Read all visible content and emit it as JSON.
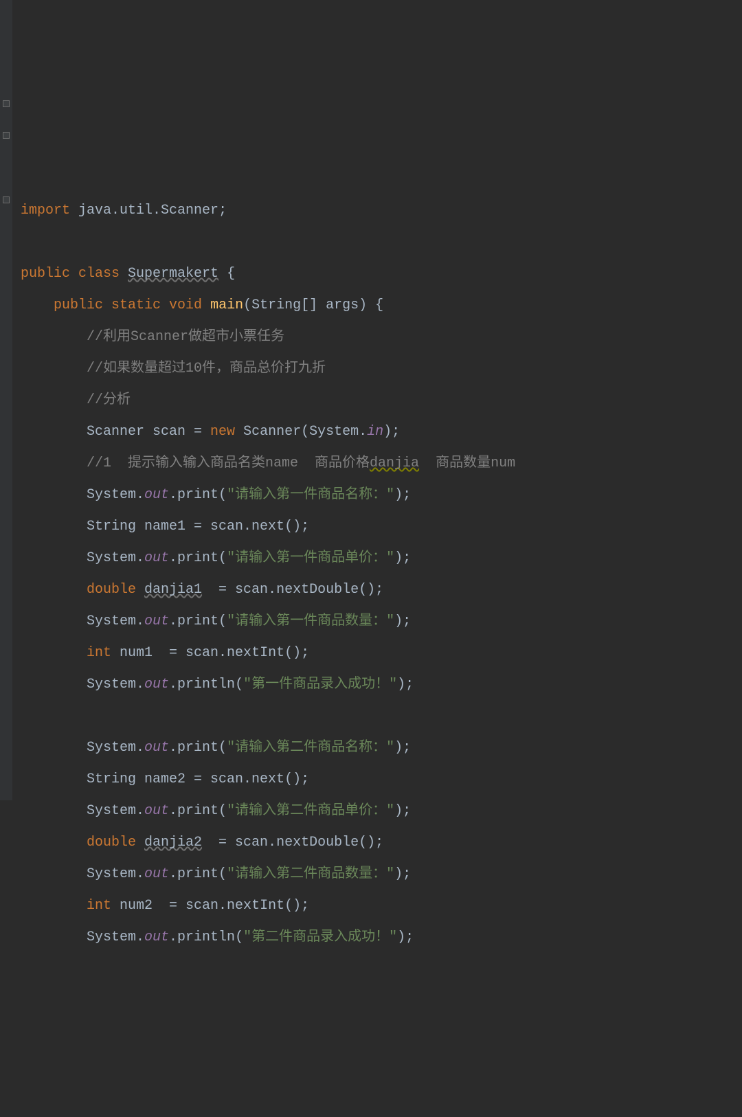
{
  "code": {
    "lines": [
      {
        "indent": 0,
        "tokens": [
          {
            "cls": "kw",
            "t": "import "
          },
          {
            "cls": "pkg",
            "t": "java.util.Scanner"
          },
          {
            "cls": "punct",
            "t": ";"
          }
        ]
      },
      {
        "indent": 0,
        "tokens": []
      },
      {
        "indent": 0,
        "tokens": [
          {
            "cls": "kw",
            "t": "public class "
          },
          {
            "cls": "cls",
            "t": "Supermakert"
          },
          {
            "cls": "punct",
            "t": " {"
          }
        ]
      },
      {
        "indent": 1,
        "tokens": [
          {
            "cls": "kw",
            "t": "public static void "
          },
          {
            "cls": "method-decl",
            "t": "main"
          },
          {
            "cls": "punct",
            "t": "(String[] args) {"
          }
        ]
      },
      {
        "indent": 2,
        "tokens": [
          {
            "cls": "comment",
            "t": "//利用Scanner做超市小票任务"
          }
        ]
      },
      {
        "indent": 2,
        "tokens": [
          {
            "cls": "comment",
            "t": "//如果数量超过10件，商品总价打九折"
          }
        ]
      },
      {
        "indent": 2,
        "tokens": [
          {
            "cls": "comment",
            "t": "//分析"
          }
        ]
      },
      {
        "indent": 2,
        "tokens": [
          {
            "cls": "type",
            "t": "Scanner scan = "
          },
          {
            "cls": "kw",
            "t": "new "
          },
          {
            "cls": "type",
            "t": "Scanner(System."
          },
          {
            "cls": "field-italic",
            "t": "in"
          },
          {
            "cls": "punct",
            "t": ");"
          }
        ]
      },
      {
        "indent": 2,
        "tokens": [
          {
            "cls": "comment",
            "t": "//1  提示输入输入商品名类name  商品价格"
          },
          {
            "cls": "comment warn-underline-y",
            "t": "danjia"
          },
          {
            "cls": "comment",
            "t": "  商品数量num"
          }
        ]
      },
      {
        "indent": 2,
        "tokens": [
          {
            "cls": "var",
            "t": "System."
          },
          {
            "cls": "field-italic",
            "t": "out"
          },
          {
            "cls": "var",
            "t": ".print("
          },
          {
            "cls": "string",
            "t": "\"请输入第一件商品名称：\""
          },
          {
            "cls": "punct",
            "t": ");"
          }
        ]
      },
      {
        "indent": 2,
        "tokens": [
          {
            "cls": "type",
            "t": "String name1 = scan.next();"
          }
        ]
      },
      {
        "indent": 2,
        "tokens": [
          {
            "cls": "var",
            "t": "System."
          },
          {
            "cls": "field-italic",
            "t": "out"
          },
          {
            "cls": "var",
            "t": ".print("
          },
          {
            "cls": "string",
            "t": "\"请输入第一件商品单价：\""
          },
          {
            "cls": "punct",
            "t": ");"
          }
        ]
      },
      {
        "indent": 2,
        "tokens": [
          {
            "cls": "kw",
            "t": "double "
          },
          {
            "cls": "var warn-underline",
            "t": "danjia1"
          },
          {
            "cls": "var",
            "t": "  = scan.nextDouble();"
          }
        ]
      },
      {
        "indent": 2,
        "tokens": [
          {
            "cls": "var",
            "t": "System."
          },
          {
            "cls": "field-italic",
            "t": "out"
          },
          {
            "cls": "var",
            "t": ".print("
          },
          {
            "cls": "string",
            "t": "\"请输入第一件商品数量：\""
          },
          {
            "cls": "punct",
            "t": ");"
          }
        ]
      },
      {
        "indent": 2,
        "tokens": [
          {
            "cls": "kw",
            "t": "int "
          },
          {
            "cls": "var",
            "t": "num1  = scan.nextInt();"
          }
        ]
      },
      {
        "indent": 2,
        "tokens": [
          {
            "cls": "var",
            "t": "System."
          },
          {
            "cls": "field-italic",
            "t": "out"
          },
          {
            "cls": "var",
            "t": ".println("
          },
          {
            "cls": "string",
            "t": "\"第一件商品录入成功！\""
          },
          {
            "cls": "punct",
            "t": ");"
          }
        ]
      },
      {
        "indent": 2,
        "tokens": []
      },
      {
        "indent": 2,
        "tokens": [
          {
            "cls": "var",
            "t": "System."
          },
          {
            "cls": "field-italic",
            "t": "out"
          },
          {
            "cls": "var",
            "t": ".print("
          },
          {
            "cls": "string",
            "t": "\"请输入第二件商品名称：\""
          },
          {
            "cls": "punct",
            "t": ");"
          }
        ]
      },
      {
        "indent": 2,
        "tokens": [
          {
            "cls": "type",
            "t": "String name2 = scan.next();"
          }
        ]
      },
      {
        "indent": 2,
        "tokens": [
          {
            "cls": "var",
            "t": "System."
          },
          {
            "cls": "field-italic",
            "t": "out"
          },
          {
            "cls": "var",
            "t": ".print("
          },
          {
            "cls": "string",
            "t": "\"请输入第二件商品单价：\""
          },
          {
            "cls": "punct",
            "t": ");"
          }
        ]
      },
      {
        "indent": 2,
        "tokens": [
          {
            "cls": "kw",
            "t": "double "
          },
          {
            "cls": "var warn-underline",
            "t": "danjia2"
          },
          {
            "cls": "var",
            "t": "  = scan.nextDouble();"
          }
        ]
      },
      {
        "indent": 2,
        "tokens": [
          {
            "cls": "var",
            "t": "System."
          },
          {
            "cls": "field-italic",
            "t": "out"
          },
          {
            "cls": "var",
            "t": ".print("
          },
          {
            "cls": "string",
            "t": "\"请输入第二件商品数量：\""
          },
          {
            "cls": "punct",
            "t": ");"
          }
        ]
      },
      {
        "indent": 2,
        "tokens": [
          {
            "cls": "kw",
            "t": "int "
          },
          {
            "cls": "var",
            "t": "num2  = scan.nextInt();"
          }
        ]
      },
      {
        "indent": 2,
        "tokens": [
          {
            "cls": "var",
            "t": "System."
          },
          {
            "cls": "field-italic",
            "t": "out"
          },
          {
            "cls": "var",
            "t": ".println("
          },
          {
            "cls": "string",
            "t": "\"第二件商品录入成功！\""
          },
          {
            "cls": "punct",
            "t": ");"
          }
        ]
      }
    ],
    "indent_unit": "    "
  }
}
